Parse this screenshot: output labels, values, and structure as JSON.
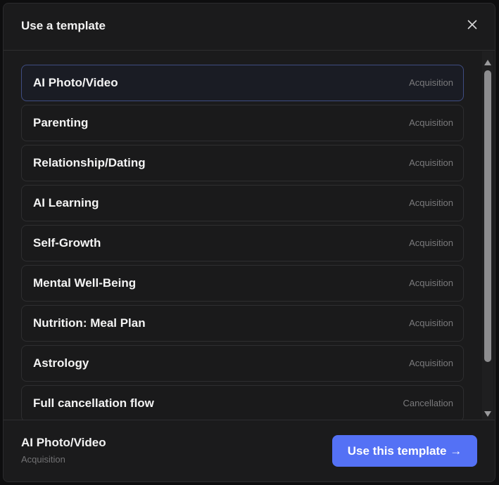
{
  "dialog": {
    "title": "Use a template",
    "close_icon": "close-icon"
  },
  "templates": [
    {
      "name": "AI Photo/Video",
      "category": "Acquisition",
      "selected": true
    },
    {
      "name": "Parenting",
      "category": "Acquisition"
    },
    {
      "name": "Relationship/Dating",
      "category": "Acquisition"
    },
    {
      "name": "AI Learning",
      "category": "Acquisition"
    },
    {
      "name": "Self-Growth",
      "category": "Acquisition"
    },
    {
      "name": "Mental Well-Being",
      "category": "Acquisition"
    },
    {
      "name": "Nutrition: Meal Plan",
      "category": "Acquisition"
    },
    {
      "name": "Astrology",
      "category": "Acquisition"
    },
    {
      "name": "Full cancellation flow",
      "category": "Cancellation"
    }
  ],
  "footer": {
    "selected_name": "AI Photo/Video",
    "selected_category": "Acquisition",
    "use_button_label": "Use this template →"
  },
  "colors": {
    "accent": "#5471f5",
    "selected_border": "#3f4d82",
    "background": "#1b1b1c"
  }
}
